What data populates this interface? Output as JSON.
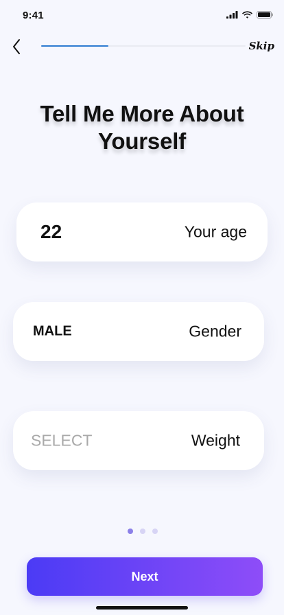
{
  "status_bar": {
    "time": "9:41",
    "signal_icon": "signal-icon",
    "wifi_icon": "wifi-icon",
    "battery_icon": "battery-icon"
  },
  "nav": {
    "back_icon": "chevron-left-icon",
    "skip_label": "Skip",
    "progress": 0.33
  },
  "title": "Tell Me More About Yourself",
  "fields": [
    {
      "value": "22",
      "label": "Your age"
    },
    {
      "value": "MALE",
      "label": "Gender"
    },
    {
      "value": "SELECT",
      "label": "Weight",
      "placeholder": true
    }
  ],
  "pagination": {
    "count": 3,
    "active": 0
  },
  "colors": {
    "accent": "#2E7BD1",
    "button_start": "#4B3BF5",
    "button_end": "#8E4DF8",
    "dot_active": "#8B80E8",
    "dot_inactive": "#D7D4F5",
    "background": "#F6F7FE"
  },
  "next_button_label": "Next"
}
